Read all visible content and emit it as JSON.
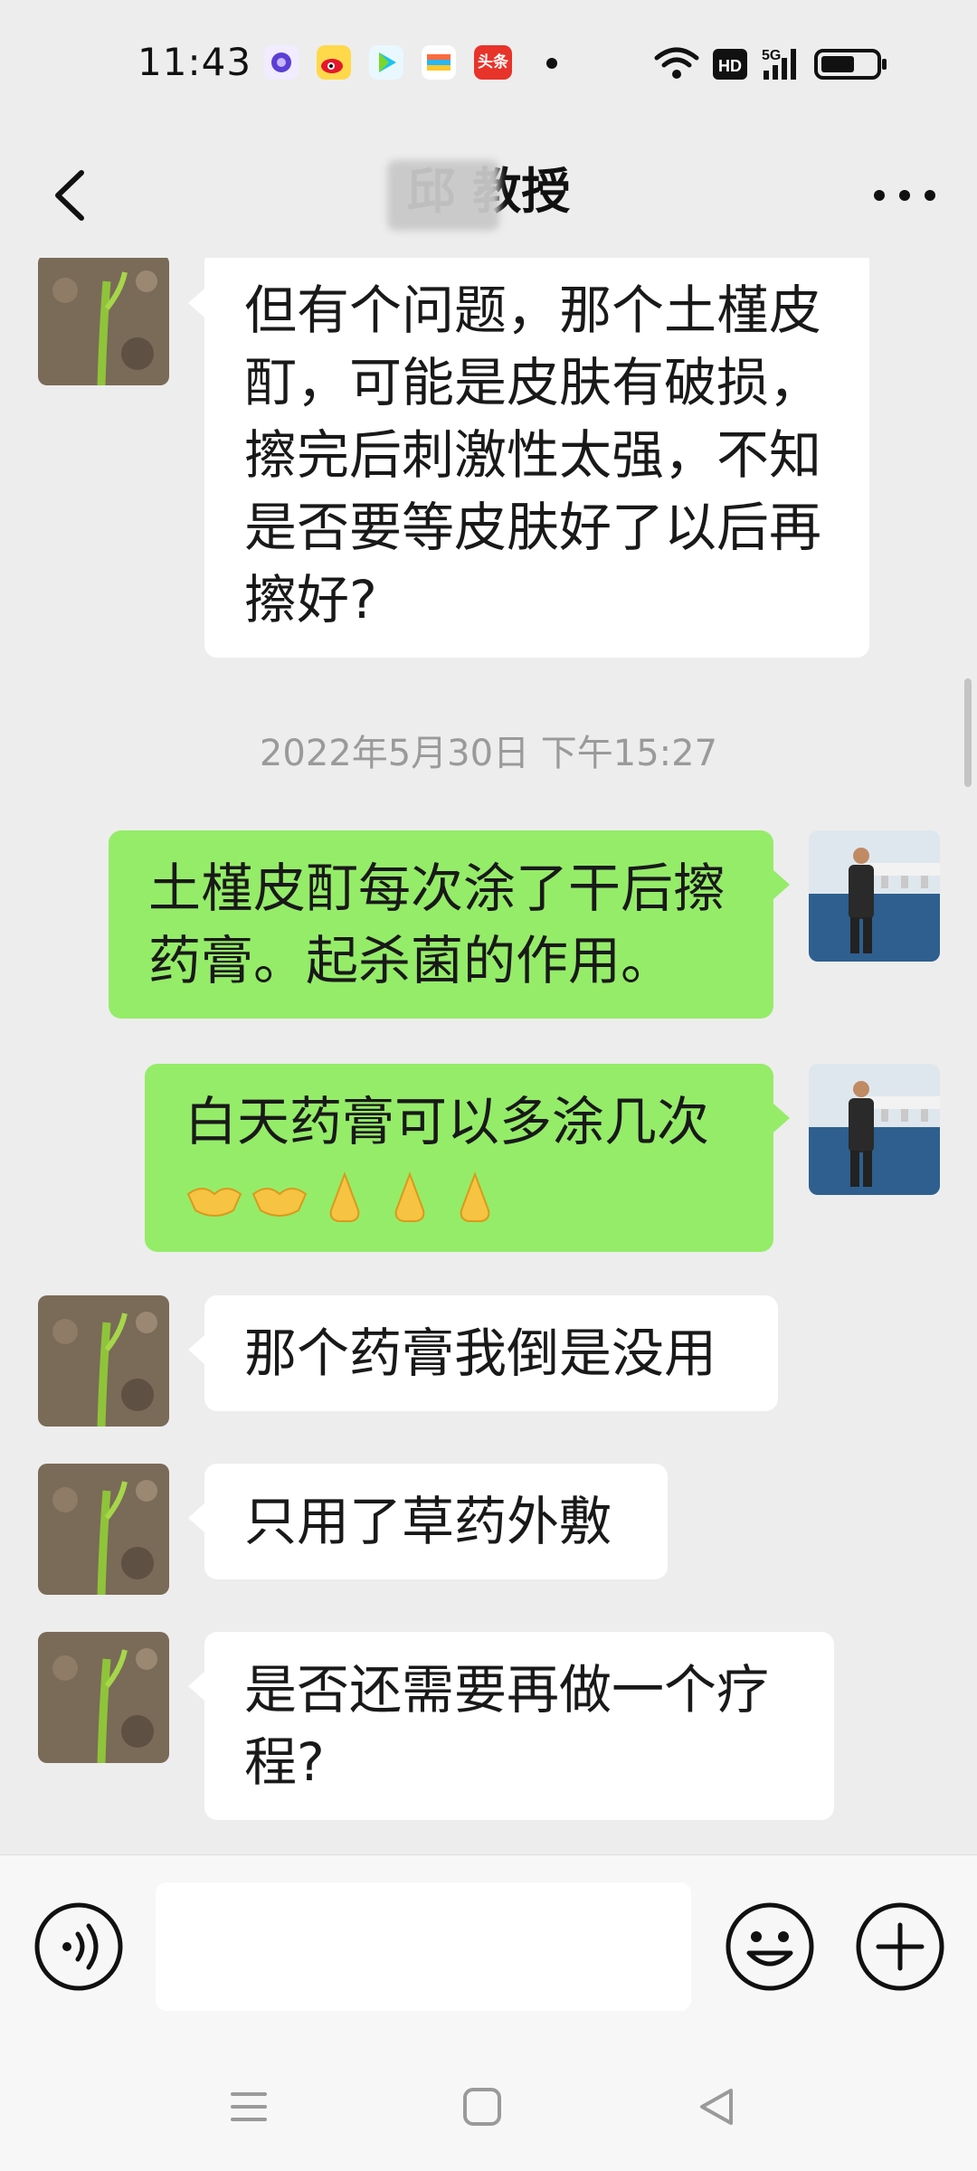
{
  "status_bar": {
    "time": "11:43",
    "notification_icons": [
      "purple-app-icon",
      "weibo-icon",
      "video-app-icon",
      "wallet-app-icon",
      "toutiao-icon"
    ],
    "toutiao_label": "头条",
    "network_hd": "HD",
    "network_5g": "5G"
  },
  "nav": {
    "title": "邱  教授"
  },
  "messages": [
    {
      "side": "in",
      "text": "但有个问题，那个土槿皮酊，可能是皮肤有破损，擦完后刺激性太强，不知是否要等皮肤好了以后再擦好?"
    },
    {
      "side": "out",
      "text": "土槿皮酊每次涂了干后擦药膏。起杀菌的作用。"
    },
    {
      "side": "out",
      "text": "白天药膏可以多涂几次",
      "emoji": [
        "handshake-emoji",
        "handshake-emoji",
        "folded-hands-emoji",
        "folded-hands-emoji",
        "folded-hands-emoji"
      ]
    },
    {
      "side": "in",
      "text": "那个药膏我倒是没用"
    },
    {
      "side": "in",
      "text": "只用了草药外敷"
    },
    {
      "side": "in",
      "text": "是否还需要再做一个疗程?"
    }
  ],
  "timestamp": "2022年5月30日 下午15:27",
  "colors": {
    "background": "#ededed",
    "incoming_bubble": "#ffffff",
    "outgoing_bubble": "#95ec69",
    "timestamp_text": "#9a9a9a"
  }
}
